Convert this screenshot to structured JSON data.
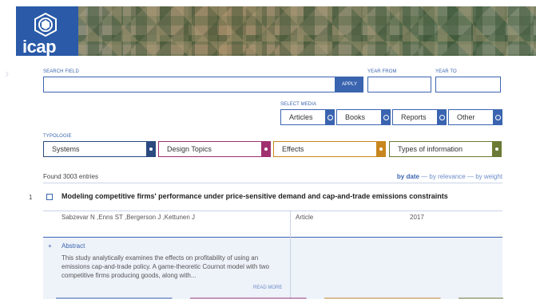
{
  "brand": {
    "logo_text": "icap"
  },
  "search": {
    "search_label": "SEARCH FIELD",
    "search_value": "",
    "apply_label": "APPLY",
    "year_from_label": "YEAR FROM",
    "year_from_value": "",
    "year_to_label": "YEAR TO",
    "year_to_value": ""
  },
  "media": {
    "label": "SELECT MEDIA",
    "items": [
      {
        "label": "Articles"
      },
      {
        "label": "Books"
      },
      {
        "label": "Reports"
      },
      {
        "label": "Other"
      }
    ]
  },
  "typology": {
    "label": "TYPOLOGIE",
    "items": [
      {
        "label": "Systems",
        "color": "#2a4a80"
      },
      {
        "label": "Design Topics",
        "color": "#a0306e"
      },
      {
        "label": "Effects",
        "color": "#c8861e"
      },
      {
        "label": "Types of information",
        "color": "#6b7a36"
      }
    ]
  },
  "results": {
    "found_text": "Found 3003 entries",
    "sort_date": "by date",
    "sort_sep": " — ",
    "sort_relevance": "by relevance",
    "sort_weight": "by weight",
    "entries": [
      {
        "number": "1",
        "title": "Modeling competitive firms' performance under price-sensitive demand and cap-and-trade emissions constraints",
        "authors": "Sabzevar N ,Enns ST ,Bergerson J ,Kettunen J",
        "type": "Article",
        "year": "2017",
        "abstract_label": "Abstract",
        "abstract_text": "This study analytically examines the effects on profitability of using an emissions cap-and-trade policy. A game-theoretic Cournot model with two competitive firms producing goods, along with...",
        "read_more": "READ MORE"
      }
    ]
  },
  "colors": {
    "accent": "#3a64b0",
    "abstract_bg": "#eef2f9"
  }
}
